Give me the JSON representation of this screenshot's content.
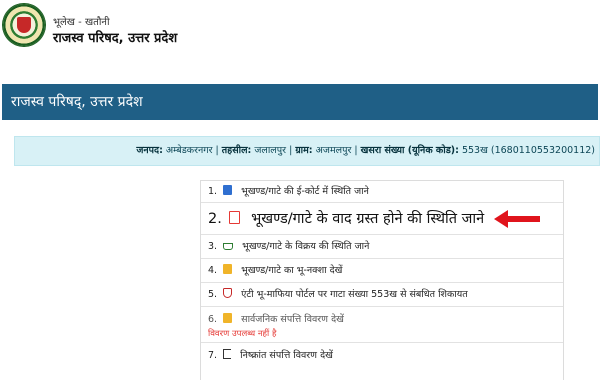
{
  "header": {
    "subtitle": "भूलेख - खतौनी",
    "title": "राजस्व परिषद, उत्तर प्रदेश"
  },
  "banner": {
    "title": "राजस्व परिषद्, उत्तर प्रदेश"
  },
  "info": {
    "district_label": "जनपद:",
    "district_value": "अम्बेडकरनगर",
    "tehsil_label": "तहसील:",
    "tehsil_value": "जलालपुर",
    "village_label": "ग्राम:",
    "village_value": "अजमलपुर",
    "khasra_label": "खसरा संख्या (यूनिक कोड):",
    "khasra_value": "553ख (1680110553200112)",
    "separator": "|"
  },
  "options": [
    {
      "number": "1.",
      "label": "भूखण्ड/गाटे की ई-कोर्ट में स्थिति जाने",
      "icon": "building-icon"
    },
    {
      "number": "2.",
      "label": "भूखण्ड/गाटे के वाद ग्रस्त होने की स्थिति जाने",
      "icon": "document-icon"
    },
    {
      "number": "3.",
      "label": "भूखण्ड/गाटे के विक्रय की स्थिति जाने",
      "icon": "cart-icon"
    },
    {
      "number": "4.",
      "label": "भूखण्ड/गाटे का भू-नक्शा देखें",
      "icon": "map-icon"
    },
    {
      "number": "5.",
      "label": "एंटी भू-माफिया पोर्टल पर गाटा संख्या 553ख से संबधित शिकायत",
      "icon": "shield-icon"
    },
    {
      "number": "6.",
      "label": "सार्वजनिक संपत्ति विवरण देखें",
      "note": "विवरण उपलब्ध नहीं है",
      "icon": "document-icon"
    },
    {
      "number": "7.",
      "label": "निष्क्रांत संपत्ति विवरण देखें",
      "icon": "exit-icon"
    }
  ],
  "colors": {
    "banner": "#1f5f86",
    "infobar": "#d8f1f6",
    "annotation_arrow": "#e0141c"
  }
}
